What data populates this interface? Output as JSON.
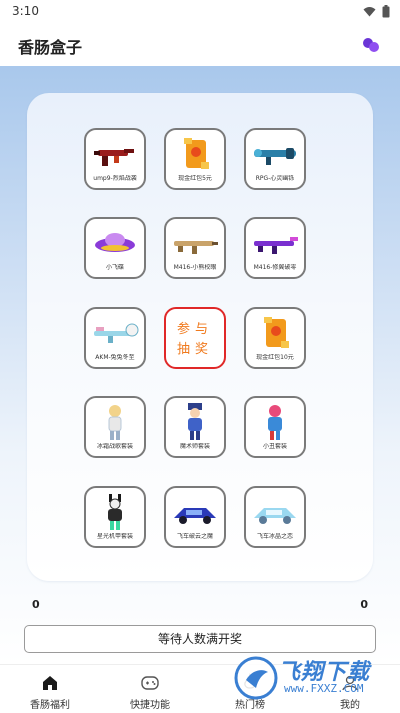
{
  "status_bar": {
    "time": "3:10"
  },
  "header": {
    "title": "香肠盒子"
  },
  "prizes": [
    {
      "label": "ump9-烈焰战袭"
    },
    {
      "label": "现金红包5元"
    },
    {
      "label": "RPG-心灵幽铄"
    },
    {
      "label": "小飞碟"
    },
    {
      "label": "M416-小熊校眼"
    },
    {
      "label": "M416-修翼破零"
    },
    {
      "label": "AKM-兔兔冬至"
    },
    {
      "label": "现金红包10元"
    },
    {
      "label": "冰霜战歌套装"
    },
    {
      "label": "魔术师套装"
    },
    {
      "label": "小丑套装"
    },
    {
      "label": "星光机甲套装"
    },
    {
      "label": "飞车破云之魔"
    },
    {
      "label": "飞车冰晶之恋"
    }
  ],
  "draw_button": {
    "line1": "参与",
    "line2": "抽奖"
  },
  "counts": {
    "left": "0",
    "right": "0"
  },
  "status_button": {
    "label": "等待人数满开奖"
  },
  "bottom_nav": [
    {
      "label": "香肠福利",
      "icon": "home-icon"
    },
    {
      "label": "快捷功能",
      "icon": "gamepad-icon"
    },
    {
      "label": "热门榜",
      "icon": "fire-icon"
    },
    {
      "label": "我的",
      "icon": "profile-icon"
    }
  ],
  "watermark": {
    "brand": "飞翔下载",
    "url": "www.FXXZ.COM"
  },
  "colors": {
    "accent": "#7b3fe4",
    "draw_border": "#e02828",
    "draw_text": "#f07a1e",
    "watermark": "#3a7fd2"
  }
}
